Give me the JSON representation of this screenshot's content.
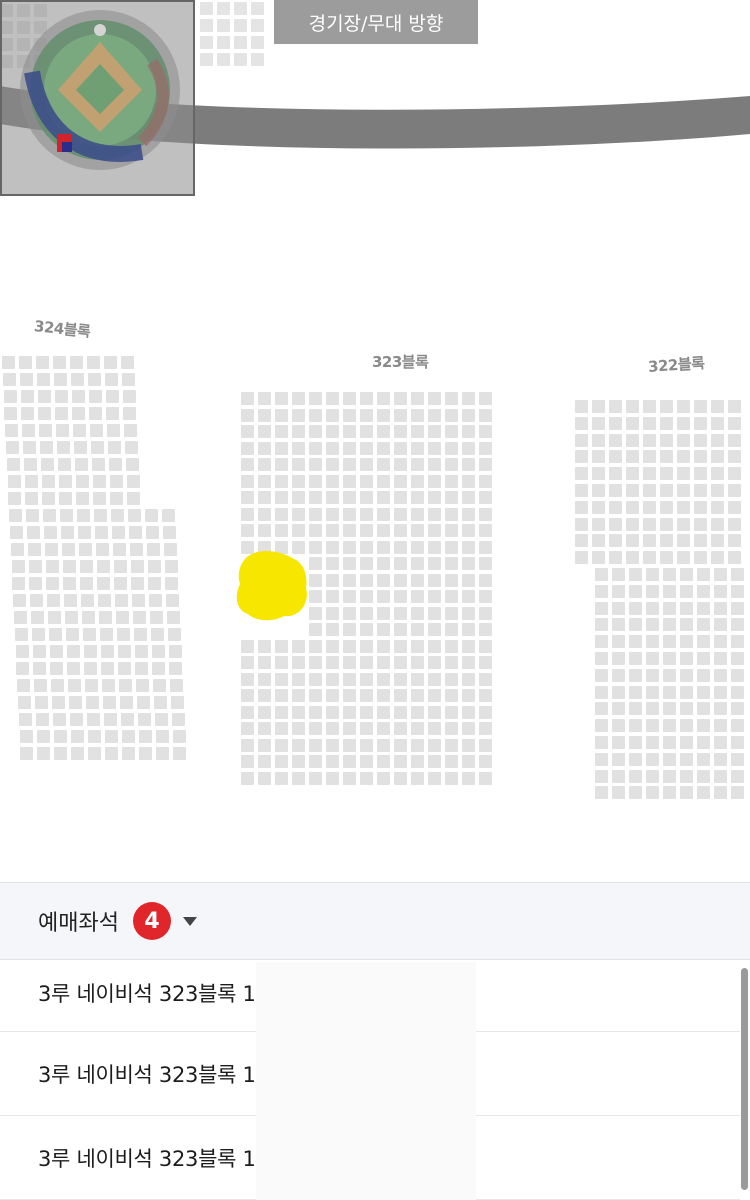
{
  "stage_direction": "경기장/무대 방향",
  "blocks": {
    "left": "324블록",
    "center": "323블록",
    "right": "322블록"
  },
  "reserved_panel": {
    "title": "예매좌석",
    "count": "4",
    "toggle_icon": "caret-down-icon"
  },
  "reserved_seats": [
    {
      "label": "3루 네이비석 323블록 1"
    },
    {
      "label": "3루 네이비석 323블록 1"
    },
    {
      "label": "3루 네이비석 323블록 1"
    }
  ],
  "colors": {
    "seat": "#e1e1e1",
    "selected_highlight": "#f7e600",
    "badge": "#e0262b",
    "banner": "#9c9c9c"
  }
}
